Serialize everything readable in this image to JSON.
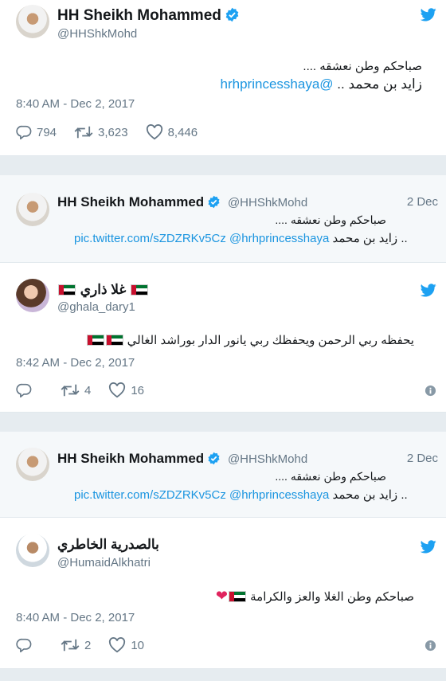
{
  "tweet1": {
    "name": "HH Sheikh Mohammed",
    "handle": "@HHShkMohd",
    "line1": "صباحكم وطن نعشقه ....",
    "line2_text": "زايد بن محمد ..",
    "line2_link": "@hrhprincesshaya",
    "timestamp": "8:40 AM - Dec 2, 2017",
    "replies": "794",
    "retweets": "3,623",
    "likes": "8,446"
  },
  "quote1": {
    "name": "HH Sheikh Mohammed",
    "handle": "@HHShkMohd",
    "date": "2 Dec",
    "line1": "صباحكم وطن نعشقه ....",
    "line2_link": "pic.twitter.com/sZDZRKv5Cz @hrhprincesshaya",
    "line2_text": ".. زايد بن محمد"
  },
  "reply1": {
    "name": "غلا ذاري",
    "handle": "@ghala_dary1",
    "text": "يحفظه ربي الرحمن ويحفظك ربي يانور الدار بوراشد الغالي",
    "timestamp": "8:42 AM - Dec 2, 2017",
    "retweets": "4",
    "likes": "16"
  },
  "quote2": {
    "name": "HH Sheikh Mohammed",
    "handle": "@HHShkMohd",
    "date": "2 Dec",
    "line1": "صباحكم وطن نعشقه ....",
    "line2_link": "pic.twitter.com/sZDZRKv5Cz @hrhprincesshaya",
    "line2_text": ".. زايد بن محمد"
  },
  "reply2": {
    "name": "بالصدرية الخاطري",
    "handle": "@HumaidAlkhatri",
    "text": "صباحكم وطن الغلا والعز والكرامة",
    "timestamp": "8:40 AM - Dec 2, 2017",
    "retweets": "2",
    "likes": "10"
  },
  "colors": {
    "twitter_blue": "#1da1f2",
    "link": "#1b95e0",
    "muted": "#657786",
    "quote_bg": "#f5f8fa",
    "heart": "#e0245e"
  },
  "icons": [
    "twitter-bird-icon",
    "verified-badge-icon",
    "reply-icon",
    "retweet-icon",
    "like-icon",
    "info-icon",
    "uae-flag-icon",
    "red-heart-icon"
  ]
}
